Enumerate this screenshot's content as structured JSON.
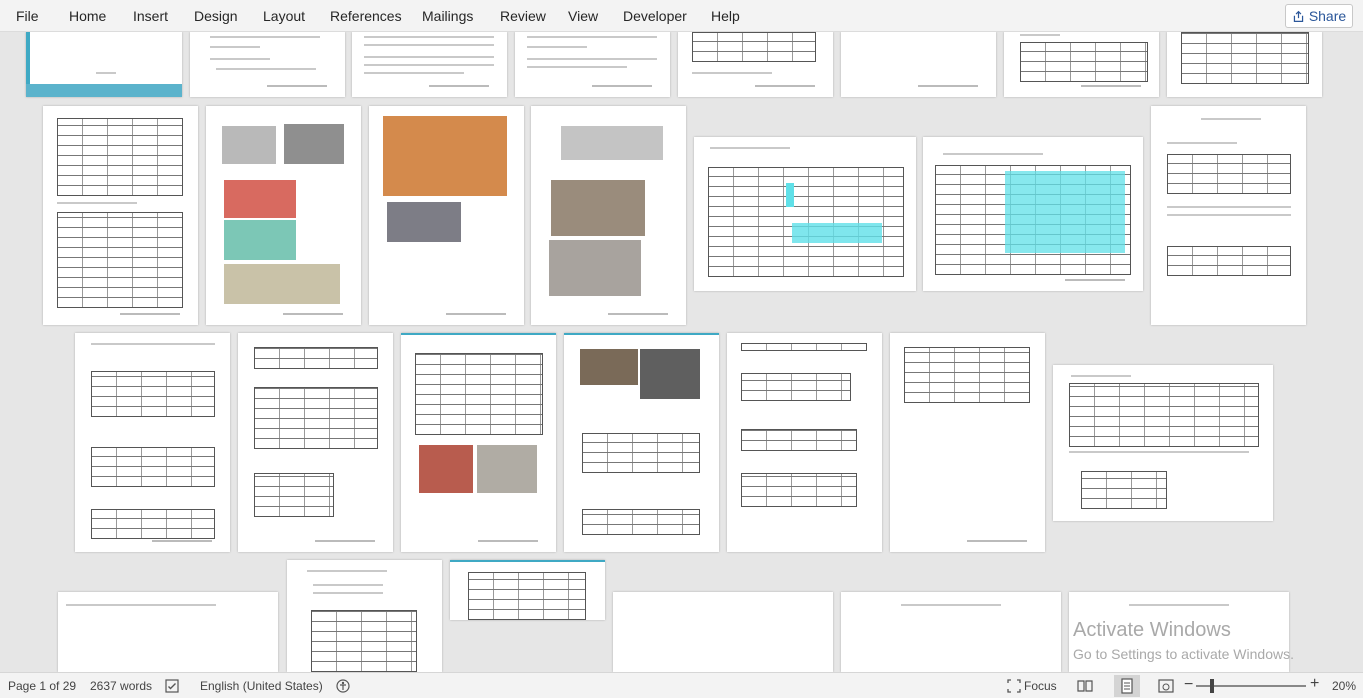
{
  "ribbon": {
    "tabs": [
      "File",
      "Home",
      "Insert",
      "Design",
      "Layout",
      "References",
      "Mailings",
      "Review",
      "View",
      "Developer",
      "Help"
    ],
    "share_label": "Share"
  },
  "status": {
    "page": "Page 1 of 29",
    "words": "2637 words",
    "language": "English (United States)",
    "focus": "Focus",
    "zoom": "20%"
  },
  "watermark": {
    "line1": "Activate Windows",
    "line2": "Go to Settings to activate Windows."
  },
  "colors": {
    "accent": "#2b579a",
    "cyan_cells": "#5fe0e8"
  }
}
